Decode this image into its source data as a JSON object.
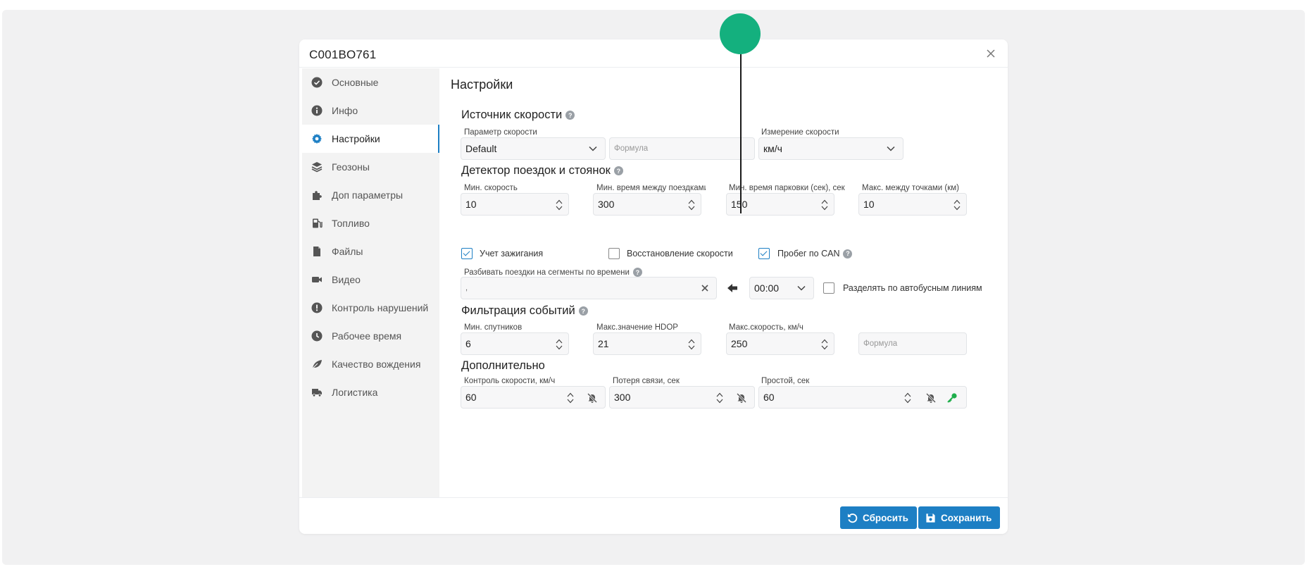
{
  "window": {
    "title": "C001BO761"
  },
  "sidebar": {
    "items": [
      {
        "label": "Основные",
        "icon": "check-circle-icon"
      },
      {
        "label": "Инфо",
        "icon": "info-icon"
      },
      {
        "label": "Настройки",
        "icon": "gear-icon",
        "active": true
      },
      {
        "label": "Геозоны",
        "icon": "layers-icon"
      },
      {
        "label": "Доп параметры",
        "icon": "puzzle-icon"
      },
      {
        "label": "Топливо",
        "icon": "fuel-icon"
      },
      {
        "label": "Файлы",
        "icon": "file-icon"
      },
      {
        "label": "Видео",
        "icon": "video-icon"
      },
      {
        "label": "Контроль нарушений",
        "icon": "alert-icon"
      },
      {
        "label": "Рабочее время",
        "icon": "clock-icon"
      },
      {
        "label": "Качество вождения",
        "icon": "leaf-icon"
      },
      {
        "label": "Логистика",
        "icon": "truck-icon"
      }
    ]
  },
  "main": {
    "title": "Настройки",
    "speed_source": {
      "title": "Источник скорости",
      "param_label": "Параметр скорости",
      "param_value": "Default",
      "formula_placeholder": "Формула",
      "unit_label": "Измерение скорости",
      "unit_value": "км/ч"
    },
    "trip_detector": {
      "title": "Детектор поездок и стоянок",
      "fields": [
        {
          "label": "Мин. скорость",
          "value": "10"
        },
        {
          "label": "Мин. время между поездками, сек",
          "value": "300"
        },
        {
          "label": "Мин. время парковки (сек), сек",
          "value": "150"
        },
        {
          "label": "Макс. между точками (км)",
          "value": "10"
        }
      ],
      "checkboxes": [
        {
          "label": "Учет зажигания",
          "checked": true
        },
        {
          "label": "Восстановление скорости",
          "checked": false
        },
        {
          "label": "Пробег по CAN",
          "checked": true
        }
      ],
      "split_label": "Разбивать поездки на сегменты по времени",
      "split_value": ",",
      "time_value": "00:00",
      "bus_lines_label": "Разделять по автобусным линиям",
      "bus_lines_checked": false
    },
    "event_filter": {
      "title": "Фильтрация событий",
      "fields": [
        {
          "label": "Мин. спутников",
          "value": "6"
        },
        {
          "label": "Макс.значение HDOP",
          "value": "21"
        },
        {
          "label": "Макс.скорость, км/ч",
          "value": "250"
        }
      ],
      "formula_placeholder": "Формула"
    },
    "extra": {
      "title": "Дополнительно",
      "fields": [
        {
          "label": "Контроль скорости, км/ч",
          "value": "60"
        },
        {
          "label": "Потеря связи, сек",
          "value": "300"
        },
        {
          "label": "Простой, сек",
          "value": "60"
        }
      ]
    }
  },
  "footer": {
    "reset_label": "Сбросить",
    "save_label": "Сохранить"
  },
  "colors": {
    "accent": "#1d7fc4",
    "marker": "#14b07e",
    "key_icon": "#1fae4b"
  }
}
